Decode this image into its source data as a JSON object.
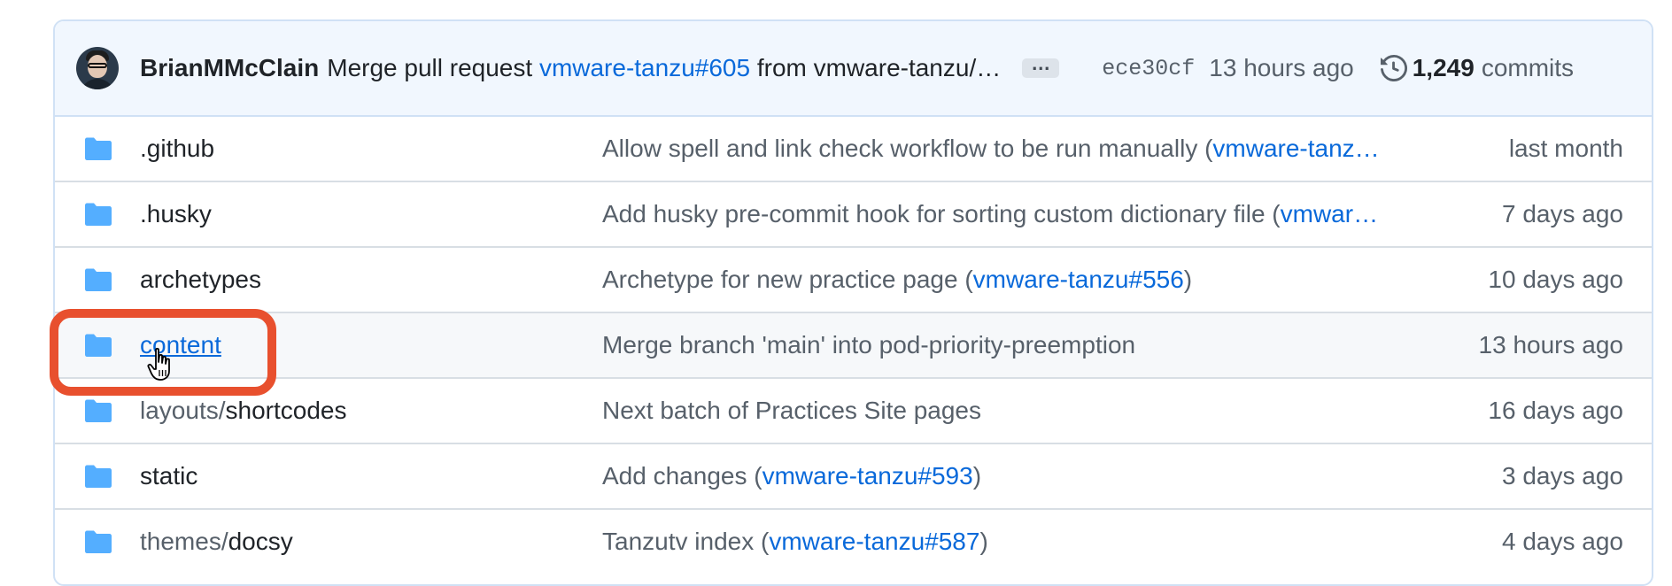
{
  "header": {
    "author": "BrianMMcClain",
    "message_prefix": "Merge pull request ",
    "message_link": "vmware-tanzu#605",
    "message_suffix": " from vmware-tanzu/…",
    "ellipsis": "…",
    "sha": "ece30cf",
    "time": "13 hours ago",
    "commit_count": "1,249",
    "commit_label": "commits",
    "icons": {
      "history": "history-icon",
      "avatar": "avatar"
    }
  },
  "rows": [
    {
      "prefix": "",
      "name": ".github",
      "msg": "Allow spell and link check workflow to be run manually (",
      "link": "vmware-tanz…",
      "suffix": "",
      "time": "last month"
    },
    {
      "prefix": "",
      "name": ".husky",
      "msg": "Add husky pre-commit hook for sorting custom dictionary file (",
      "link": "vmwar…",
      "suffix": "",
      "time": "7 days ago"
    },
    {
      "prefix": "",
      "name": "archetypes",
      "msg": "Archetype for new practice page (",
      "link": "vmware-tanzu#556",
      "suffix": ")",
      "time": "10 days ago"
    },
    {
      "prefix": "",
      "name": "content",
      "msg": "Merge branch 'main' into pod-priority-preemption",
      "link": "",
      "suffix": "",
      "time": "13 hours ago"
    },
    {
      "prefix": "layouts/",
      "name": "shortcodes",
      "msg": "Next batch of Practices Site pages",
      "link": "",
      "suffix": "",
      "time": "16 days ago"
    },
    {
      "prefix": "",
      "name": "static",
      "msg": "Add changes (",
      "link": "vmware-tanzu#593",
      "suffix": ")",
      "time": "3 days ago"
    },
    {
      "prefix": "themes/",
      "name": "docsy",
      "msg": "Tanzutv index (",
      "link": "vmware-tanzu#587",
      "suffix": ")",
      "time": "4 days ago"
    }
  ],
  "colors": {
    "folder": "#54aeff",
    "link": "#0969da",
    "highlight": "#e8502e",
    "header_bg": "#f1f7fe"
  }
}
